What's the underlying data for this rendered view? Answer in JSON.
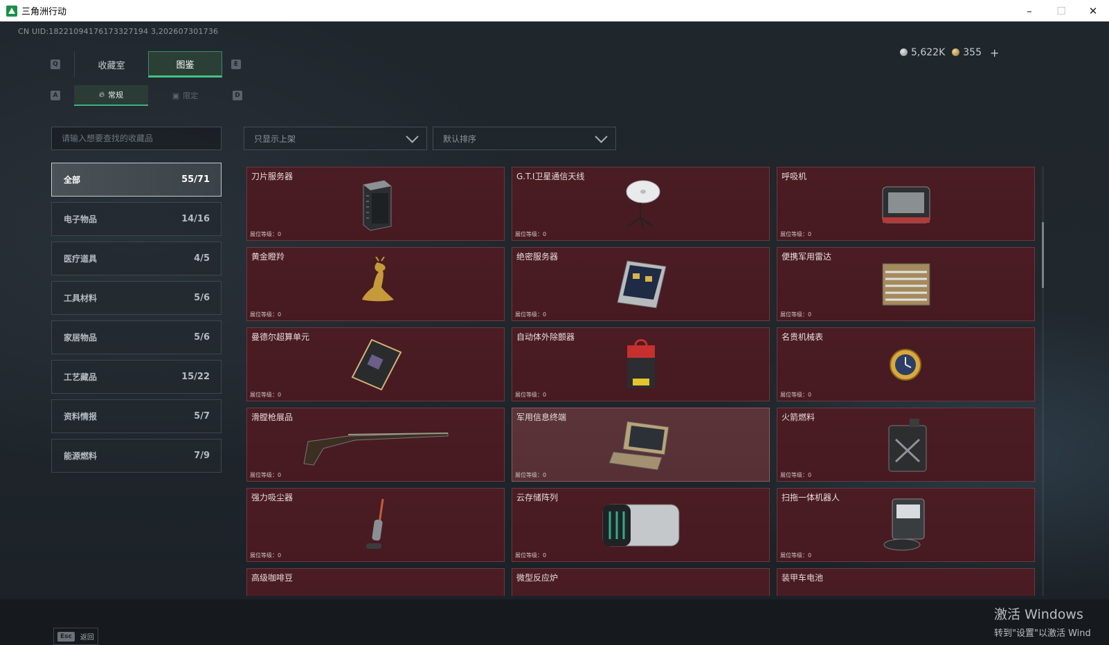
{
  "window": {
    "title": "三角洲行动",
    "controls": [
      "–",
      "☐",
      "✕"
    ]
  },
  "uid": "CN UID:18221094176173327194 3,202607301736",
  "currency": {
    "silver": "5,622K",
    "gold": "355",
    "plus": "+"
  },
  "hotkeys": {
    "q": "Q",
    "e": "E",
    "a": "A",
    "d": "D"
  },
  "main_tabs": [
    {
      "label": "收藏室"
    },
    {
      "label": "图鉴"
    }
  ],
  "sub_tabs": [
    {
      "label": "常规"
    },
    {
      "label": "限定"
    }
  ],
  "search": {
    "placeholder": "请输入想要查找的收藏品"
  },
  "filter": {
    "label": "只显示上架"
  },
  "sort": {
    "label": "默认排序"
  },
  "categories": [
    {
      "label": "全部",
      "count": "55/71"
    },
    {
      "label": "电子物品",
      "count": "14/16"
    },
    {
      "label": "医疗道具",
      "count": "4/5"
    },
    {
      "label": "工具材料",
      "count": "5/6"
    },
    {
      "label": "家居物品",
      "count": "5/6"
    },
    {
      "label": "工艺藏品",
      "count": "15/22"
    },
    {
      "label": "资料情报",
      "count": "5/7"
    },
    {
      "label": "能源燃料",
      "count": "7/9"
    }
  ],
  "level_label": "展位等级：0",
  "items": [
    {
      "name": "刀片服务器",
      "icon": "blade-server-icon"
    },
    {
      "name": "G.T.I卫星通信天线",
      "icon": "satellite-antenna-icon"
    },
    {
      "name": "呼吸机",
      "icon": "ventilator-icon"
    },
    {
      "name": "黄金瞪羚",
      "icon": "golden-gazelle-icon"
    },
    {
      "name": "绝密服务器",
      "icon": "secret-server-icon"
    },
    {
      "name": "便携军用雷达",
      "icon": "portable-radar-icon"
    },
    {
      "name": "曼德尔超算单元",
      "icon": "supercomputer-unit-icon"
    },
    {
      "name": "自动体外除颤器",
      "icon": "defibrillator-icon"
    },
    {
      "name": "名贵机械表",
      "icon": "luxury-watch-icon"
    },
    {
      "name": "滑膛枪展品",
      "icon": "musket-icon"
    },
    {
      "name": "军用信息终端",
      "icon": "military-terminal-icon"
    },
    {
      "name": "火箭燃料",
      "icon": "rocket-fuel-icon"
    },
    {
      "name": "强力吸尘器",
      "icon": "vacuum-cleaner-icon"
    },
    {
      "name": "云存储阵列",
      "icon": "cloud-storage-icon"
    },
    {
      "name": "扫拖一体机器人",
      "icon": "mop-robot-icon"
    },
    {
      "name": "高级咖啡豆",
      "icon": "coffee-beans-icon"
    },
    {
      "name": "微型反应炉",
      "icon": "micro-reactor-icon"
    },
    {
      "name": "装甲车电池",
      "icon": "vehicle-battery-icon"
    }
  ],
  "footer": {
    "esc_key": "Esc",
    "back_label": "返回"
  },
  "activation": {
    "line1": "激活 Windows",
    "line2": "转到\"设置\"以激活 Wind"
  }
}
